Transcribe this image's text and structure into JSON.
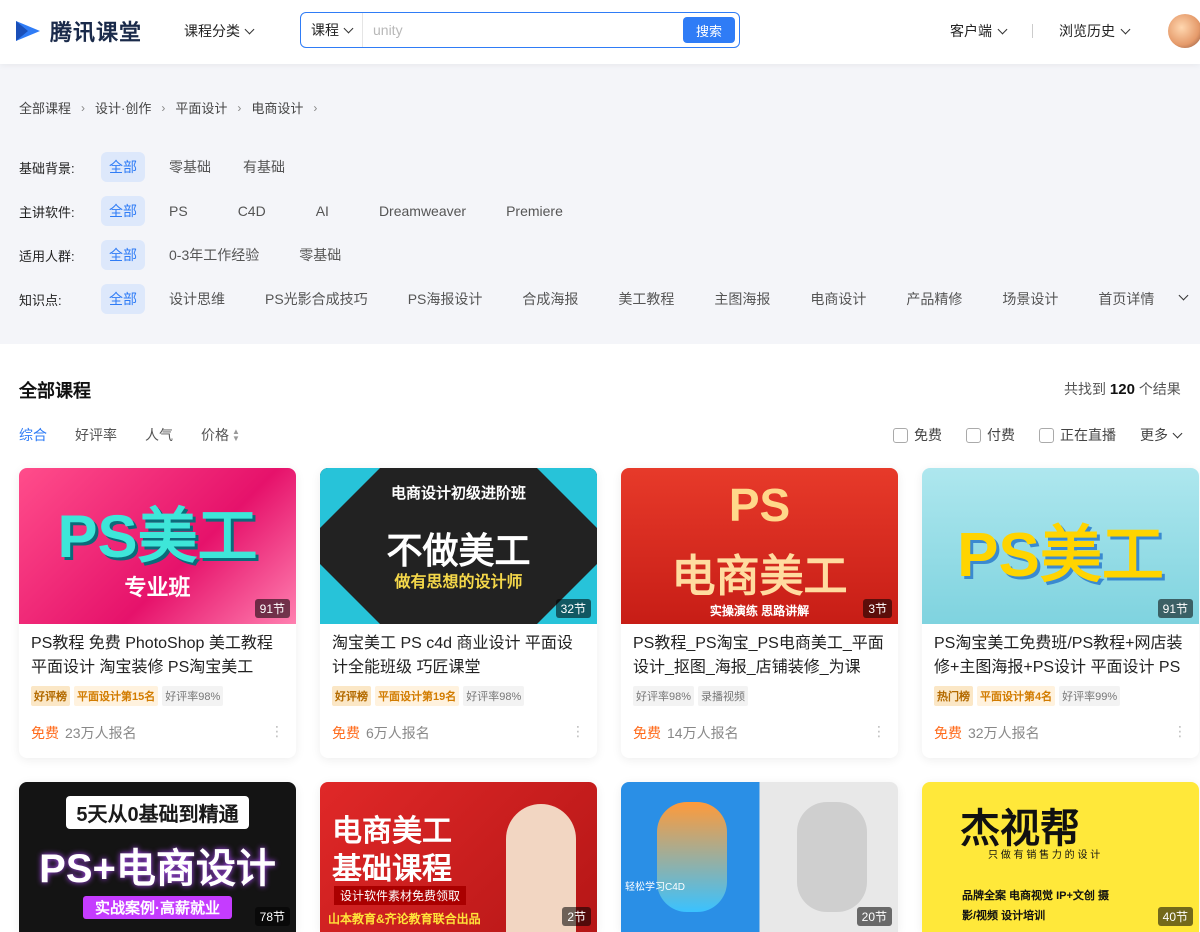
{
  "header": {
    "logo_text": "腾讯课堂",
    "category_menu": "课程分类",
    "search": {
      "type": "课程",
      "placeholder": "unity",
      "button": "搜索"
    },
    "client": "客户端",
    "history": "浏览历史"
  },
  "breadcrumb": [
    "全部课程",
    "设计·创作",
    "平面设计",
    "电商设计"
  ],
  "filters": [
    {
      "label": "基础背景:",
      "options": [
        "全部",
        "零基础",
        "有基础"
      ]
    },
    {
      "label": "主讲软件:",
      "options": [
        "全部",
        "PS",
        "C4D",
        "AI",
        "Dreamweaver",
        "Premiere"
      ]
    },
    {
      "label": "适用人群:",
      "options": [
        "全部",
        "0-3年工作经验",
        "零基础"
      ]
    },
    {
      "label": "知识点:",
      "options": [
        "全部",
        "设计思维",
        "PS光影合成技巧",
        "PS海报设计",
        "合成海报",
        "美工教程",
        "主图海报",
        "电商设计",
        "产品精修",
        "场景设计",
        "首页详情"
      ]
    }
  ],
  "list": {
    "title": "全部课程",
    "result_prefix": "共找到",
    "result_count": "120",
    "result_suffix": "个结果",
    "sorts": [
      "综合",
      "好评率",
      "人气",
      "价格"
    ],
    "checks": [
      "免费",
      "付费",
      "正在直播"
    ],
    "more": "更多"
  },
  "courses": [
    {
      "title": "PS教程 免费 PhotoShop 美工教程 平面设计 淘宝装修 PS淘宝美工",
      "lessons": "91节",
      "tags": [
        "好评榜",
        "平面设计第15名",
        "好评率98%"
      ],
      "price": "免费",
      "enroll": "23万人报名",
      "cover_main": "PS美工",
      "cover_sub": "专业班"
    },
    {
      "title": "淘宝美工 PS c4d 商业设计 平面设计全能班级 巧匠课堂",
      "lessons": "32节",
      "tags": [
        "好评榜",
        "平面设计第19名",
        "好评率98%"
      ],
      "price": "免费",
      "enroll": "6万人报名",
      "cover_top": "电商设计初级进阶班",
      "cover_main": "不做美工",
      "cover_sub": "做有思想的设计师"
    },
    {
      "title": "PS教程_PS淘宝_PS电商美工_平面设计_抠图_海报_店铺装修_为课",
      "lessons": "3节",
      "tags": [
        "好评率98%",
        "录播视频"
      ],
      "price": "免费",
      "enroll": "14万人报名",
      "cover_top": "PS",
      "cover_main": "电商美工",
      "cover_sub": "实操演练 思路讲解"
    },
    {
      "title": "PS淘宝美工免费班/PS教程+网店装修+主图海报+PS设计 平面设计 PS",
      "lessons": "91节",
      "tags": [
        "热门榜",
        "平面设计第4名",
        "好评率99%"
      ],
      "price": "免费",
      "enroll": "32万人报名",
      "cover_main": "PS美工"
    },
    {
      "lessons": "78节",
      "cover_top": "5天从0基础到精通",
      "cover_main": "PS+电商设计",
      "cover_sub": "实战案例·高薪就业"
    },
    {
      "lessons": "2节",
      "cover_main": "电商美工",
      "cover_main2": "基础课程",
      "cover_sub": "设计软件素材免费领取",
      "cover_foot": "山本教育&齐论教育联合出品"
    },
    {
      "lessons": "20节",
      "cover_top": "轻松学习C4D"
    },
    {
      "lessons": "40节",
      "cover_main": "杰视帮",
      "cover_sub": "只 做 有 销 售 力 的 设 计",
      "cover_foot": "品牌全案 电商视觉 IP+文创 摄影/视频 设计培训"
    }
  ],
  "colors": {
    "accent": "#2f7cf6",
    "price": "#ff6a1a",
    "bg_filter": "#f4f5f9"
  }
}
